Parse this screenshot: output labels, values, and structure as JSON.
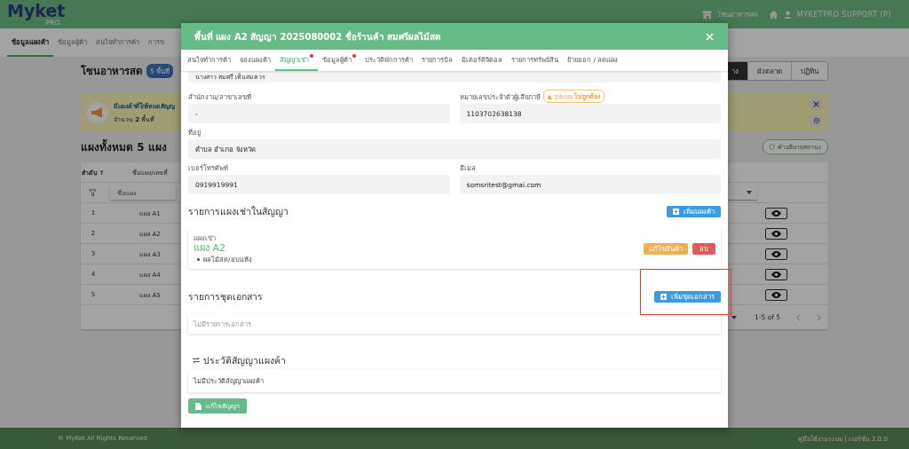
{
  "header": {
    "logo": "Myket",
    "logo_sub": "PRO",
    "zone": "โซนอาหารสด",
    "user": "MYKETPRO SUPPORT (P)"
  },
  "nav_tabs": [
    {
      "label": "ข้อมูลแผงค้า",
      "selected": true
    },
    {
      "label": "ข้อมูลผู้ค้า",
      "selected": false
    },
    {
      "label": "สนใจทำการค้า",
      "selected": false
    },
    {
      "label": "การข",
      "selected": false
    }
  ],
  "page": {
    "title": "โซนอาหารสด",
    "badge": "5 พื้นที่",
    "view_buttons": [
      {
        "label": "าง",
        "selected": true
      },
      {
        "label": "ผังตลาด",
        "selected": false
      },
      {
        "label": "ปฏิทิน",
        "selected": false
      }
    ],
    "banner": {
      "title": "มีแผงค้าที่ใกล้หมดสัญญ",
      "text": "จำนวน **2** พื้นที่"
    },
    "summary": "แผงทั้งหมด 5 แผง",
    "legend_button": "คำอธิบายสถานะ",
    "table": {
      "columns": [
        "ลำดับ ↑",
        "ชื่อแผง/เลขที่"
      ],
      "filter_placeholder": "ชื่อแผง",
      "rows": [
        {
          "index": "1",
          "name": "แผง A1"
        },
        {
          "index": "2",
          "name": "แผง A2"
        },
        {
          "index": "3",
          "name": "แผง A3"
        },
        {
          "index": "4",
          "name": "แผง A4"
        },
        {
          "index": "5",
          "name": "แผง A5"
        }
      ],
      "pagination": "1-5 of 5"
    }
  },
  "footer": {
    "copyright": "© MyKet All Rights Reserved",
    "links": "คู่มือใช้งานระบบ | เวอร์ชั่น 2.0.0"
  },
  "modal": {
    "title": "พื้นที่ แผง A2 สัญญา 2025080002 ชื่อร้านค้า สมศรีผลไม้สด",
    "tabs": [
      {
        "label": "สนใจทำการค้า",
        "selected": false,
        "alert": false
      },
      {
        "label": "จองแผงค้า",
        "selected": false,
        "alert": false
      },
      {
        "label": "สัญญาเช่า",
        "selected": true,
        "alert": true
      },
      {
        "label": "ข้อมูลผู้ค้า",
        "selected": false,
        "alert": true
      },
      {
        "label": "ประวัติพักการค้า",
        "selected": false,
        "alert": false
      },
      {
        "label": "รายการบิล",
        "selected": false,
        "alert": false
      },
      {
        "label": "มิเตอร์ดิจิตอล",
        "selected": false,
        "alert": false
      },
      {
        "label": "รายการทรัพย์สิน",
        "selected": false,
        "alert": false
      },
      {
        "label": "ย้ายออก / ลดแผง",
        "selected": false,
        "alert": false
      }
    ],
    "top_value": "นางสาว สมศรี เห็นสมควร",
    "fields": [
      {
        "label": "สำนักงาน/สาขาเลขที่",
        "value": "-",
        "wide": false
      },
      {
        "label": "หมายเลขประจำตัวผู้เสียภาษี",
        "value": "1103702638138",
        "wide": false,
        "warning": "▲ รูปแบบ **ไม่ถูกต้อง**"
      },
      {
        "label": "ที่อยู่",
        "value": "ตำบล อำเภอ จังหวัด",
        "wide": true
      },
      {
        "label": "เบอร์โทรศัพท์",
        "value": "0919919991",
        "wide": false
      },
      {
        "label": "อีเมล",
        "value": "somsritest@gmai.com",
        "wide": false
      }
    ],
    "stalls_section": {
      "title": "รายการแผงเช่าในสัญญา",
      "add_button": "เพิ่มแผงค้า",
      "items": [
        {
          "caption": "แผงเช่า",
          "name": "แผง A2",
          "products": [
            "ผลไม้สด/อบแห้ง"
          ],
          "edit_button": "แก้ไขสินค้า",
          "delete_button": "ลบ"
        }
      ]
    },
    "documents_section": {
      "title": "รายการชุดเอกสาร",
      "add_button": "เพิ่มชุดเอกสาร",
      "highlighted": true,
      "empty_text": "ไม่มีรายการเอกสาร"
    },
    "history_section": {
      "title": "ประวัติสัญญาแผงค้า",
      "empty_text": "ไม่มีประวัติสัญญาแผงค้า"
    },
    "edit_button": "แก้ไขสัญญา"
  }
}
